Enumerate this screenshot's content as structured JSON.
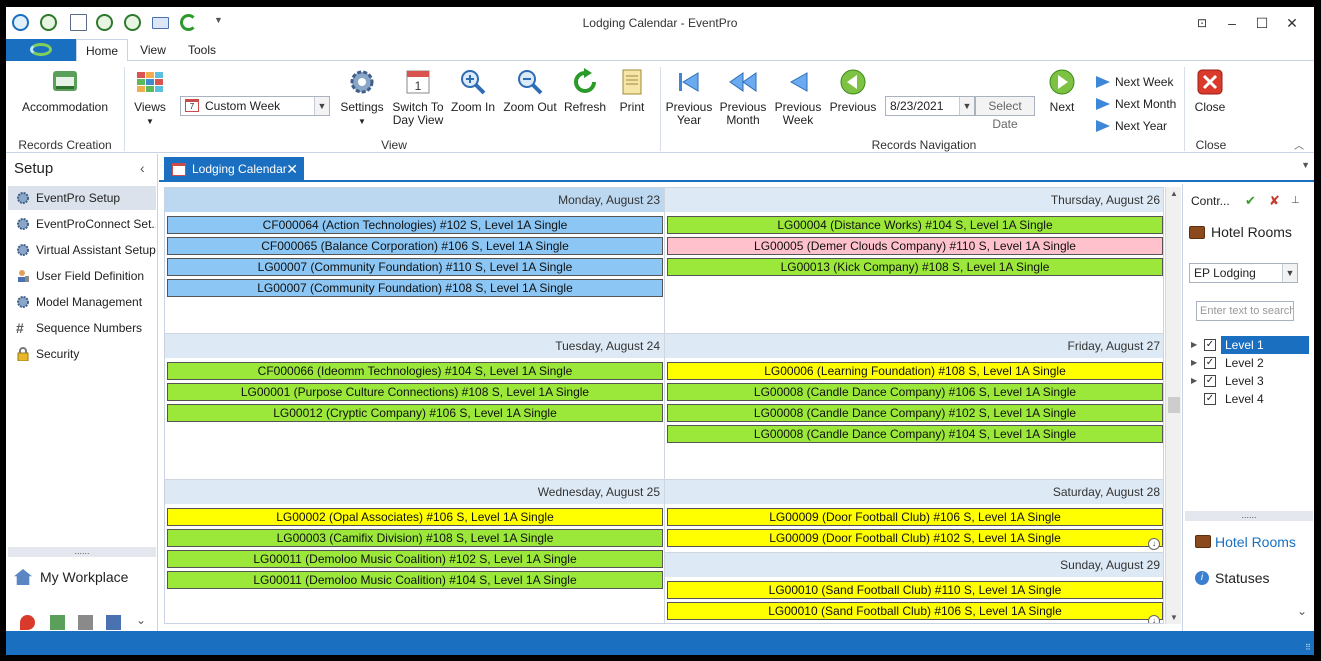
{
  "window": {
    "title": "Lodging Calendar - EventPro"
  },
  "ribbon_tabs": [
    "Home",
    "View",
    "Tools"
  ],
  "ribbon": {
    "records_creation": {
      "accommodation": "Accommodation",
      "group": "Records Creation"
    },
    "view": {
      "views": "Views",
      "view_combo": "Custom Week",
      "settings": "Settings",
      "switch_to_day_view": "Switch To Day View",
      "zoom_in": "Zoom In",
      "zoom_out": "Zoom Out",
      "refresh": "Refresh",
      "print": "Print",
      "group": "View"
    },
    "records_navigation": {
      "previous_year": "Previous Year",
      "previous_month": "Previous Month",
      "previous_week": "Previous Week",
      "previous": "Previous",
      "date": "8/23/2021",
      "select_date": "Select Date",
      "next": "Next",
      "next_week": "Next Week",
      "next_month": "Next Month",
      "next_year": "Next Year",
      "group": "Records Navigation"
    },
    "close": {
      "close": "Close",
      "group": "Close"
    }
  },
  "sidebar": {
    "title": "Setup",
    "items": [
      "EventPro Setup",
      "EventProConnect Set...",
      "Virtual Assistant Setup",
      "User Field Definition",
      "Model Management",
      "Sequence Numbers",
      "Security"
    ],
    "workplace": "My Workplace"
  },
  "doc_tab": "Lodging Calendar",
  "calendar": {
    "left_days": [
      {
        "label": "Monday, August 23",
        "appts": [
          {
            "text": "CF000064 (Action Technologies) #102 S, Level 1A Single",
            "color": "blue"
          },
          {
            "text": "CF000065 (Balance Corporation) #106 S, Level 1A Single",
            "color": "blue"
          },
          {
            "text": "LG00007 (Community Foundation) #110 S, Level 1A Single",
            "color": "blue"
          },
          {
            "text": "LG00007 (Community Foundation) #108 S, Level 1A Single",
            "color": "blue"
          }
        ]
      },
      {
        "label": "Tuesday, August 24",
        "appts": [
          {
            "text": "CF000066 (Ideomm Technologies) #104 S, Level 1A Single",
            "color": "green"
          },
          {
            "text": "LG00001 (Purpose Culture Connections) #108 S, Level 1A Single",
            "color": "green"
          },
          {
            "text": "LG00012 (Cryptic Company) #106 S, Level 1A Single",
            "color": "green"
          }
        ]
      },
      {
        "label": "Wednesday, August 25",
        "appts": [
          {
            "text": "LG00002 (Opal Associates) #106 S, Level 1A Single",
            "color": "yellow"
          },
          {
            "text": "LG00003 (Camifix Division) #108 S, Level 1A Single",
            "color": "green"
          },
          {
            "text": "LG00011 (Demoloo Music Coalition) #102 S, Level 1A Single",
            "color": "green"
          },
          {
            "text": "LG00011 (Demoloo Music Coalition) #104 S, Level 1A Single",
            "color": "green"
          }
        ]
      }
    ],
    "right_days": [
      {
        "label": "Thursday, August 26",
        "appts": [
          {
            "text": "LG00004 (Distance Works) #104 S, Level 1A Single",
            "color": "green"
          },
          {
            "text": "LG00005 (Demer Clouds Company) #110 S, Level 1A Single",
            "color": "pink"
          },
          {
            "text": "LG00013 (Kick Company) #108 S, Level 1A Single",
            "color": "green"
          }
        ]
      },
      {
        "label": "Friday, August 27",
        "appts": [
          {
            "text": "LG00006 (Learning Foundation) #108 S, Level 1A Single",
            "color": "yellow"
          },
          {
            "text": "LG00008 (Candle Dance Company) #106 S, Level 1A Single",
            "color": "green"
          },
          {
            "text": "LG00008 (Candle Dance Company) #102 S, Level 1A Single",
            "color": "green"
          },
          {
            "text": "LG00008 (Candle Dance Company) #104 S, Level 1A Single",
            "color": "green"
          }
        ]
      },
      {
        "label": "Saturday, August 28",
        "appts": [
          {
            "text": "LG00009 (Door Football Club) #106 S, Level 1A Single",
            "color": "yellow"
          },
          {
            "text": "LG00009 (Door Football Club) #102 S, Level 1A Single",
            "color": "yellow"
          }
        ]
      },
      {
        "label": "Sunday, August 29",
        "appts": [
          {
            "text": "LG00010 (Sand Football Club) #110 S, Level 1A Single",
            "color": "yellow"
          },
          {
            "text": "LG00010 (Sand Football Club) #106 S, Level 1A Single",
            "color": "yellow"
          }
        ]
      }
    ]
  },
  "right_panel": {
    "header": "Contr...",
    "title": "Hotel Rooms",
    "combo": "EP Lodging",
    "search_placeholder": "Enter text to search",
    "levels": [
      "Level 1",
      "Level 2",
      "Level 3",
      "Level 4"
    ],
    "links": [
      "Hotel Rooms",
      "Statuses"
    ]
  },
  "colors": {
    "accent": "#1a6fc0",
    "blue": "#8bc6f4",
    "green": "#9be83a",
    "pink": "#ffc1cc",
    "yellow": "#ffff00"
  }
}
